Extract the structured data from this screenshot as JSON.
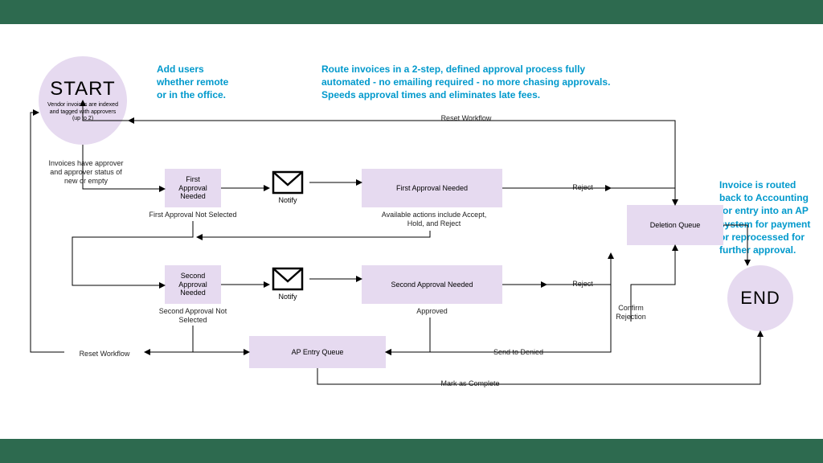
{
  "callouts": {
    "addUsers": "Add users\nwhether remote\nor in the office.",
    "routeInvoices": "Route invoices in a 2-step, defined approval process fully\nautomated - no emailing required - no more chasing approvals.\nSpeeds approval times and eliminates late fees.",
    "endCallout": "Invoice is routed\nback to Accounting\nfor entry into an AP\nsystem for payment\nor reprocessed for\nfurther approval."
  },
  "nodes": {
    "start": {
      "title": "START",
      "sub": "Vendor invoices are indexed\nand tagged with approvers\n(up to 2)"
    },
    "firstApprovalNeededBox1": "First\nApproval\nNeeded",
    "firstApprovalNeededBox2": "First Approval Needed",
    "secondApprovalNeededBox1": "Second\nApproval\nNeeded",
    "secondApprovalNeededBox2": "Second Approval Needed",
    "apEntryQueue": "AP Entry Queue",
    "deletionQueue": "Deletion Queue",
    "end": "END"
  },
  "labels": {
    "invoicesHaveApprover": "Invoices have approver\nand approver status of\nnew or empty",
    "firstApprovalNotSelected": "First Approval Not Selected",
    "secondApprovalNotSelected": "Second Approval Not\nSelected",
    "availableActions": "Available actions include Accept,\nHold, and Reject",
    "approved": "Approved",
    "notify1": "Notify",
    "notify2": "Notify",
    "reject1": "Reject",
    "reject2": "Reject",
    "confirmRejection": "Confirm\nRejection",
    "resetWorkflowTop": "Reset Workflow",
    "resetWorkflowLeft": "Reset Workflow",
    "sendToDenied": "Send to Denied",
    "markAsComplete": "Mark as Complete"
  }
}
